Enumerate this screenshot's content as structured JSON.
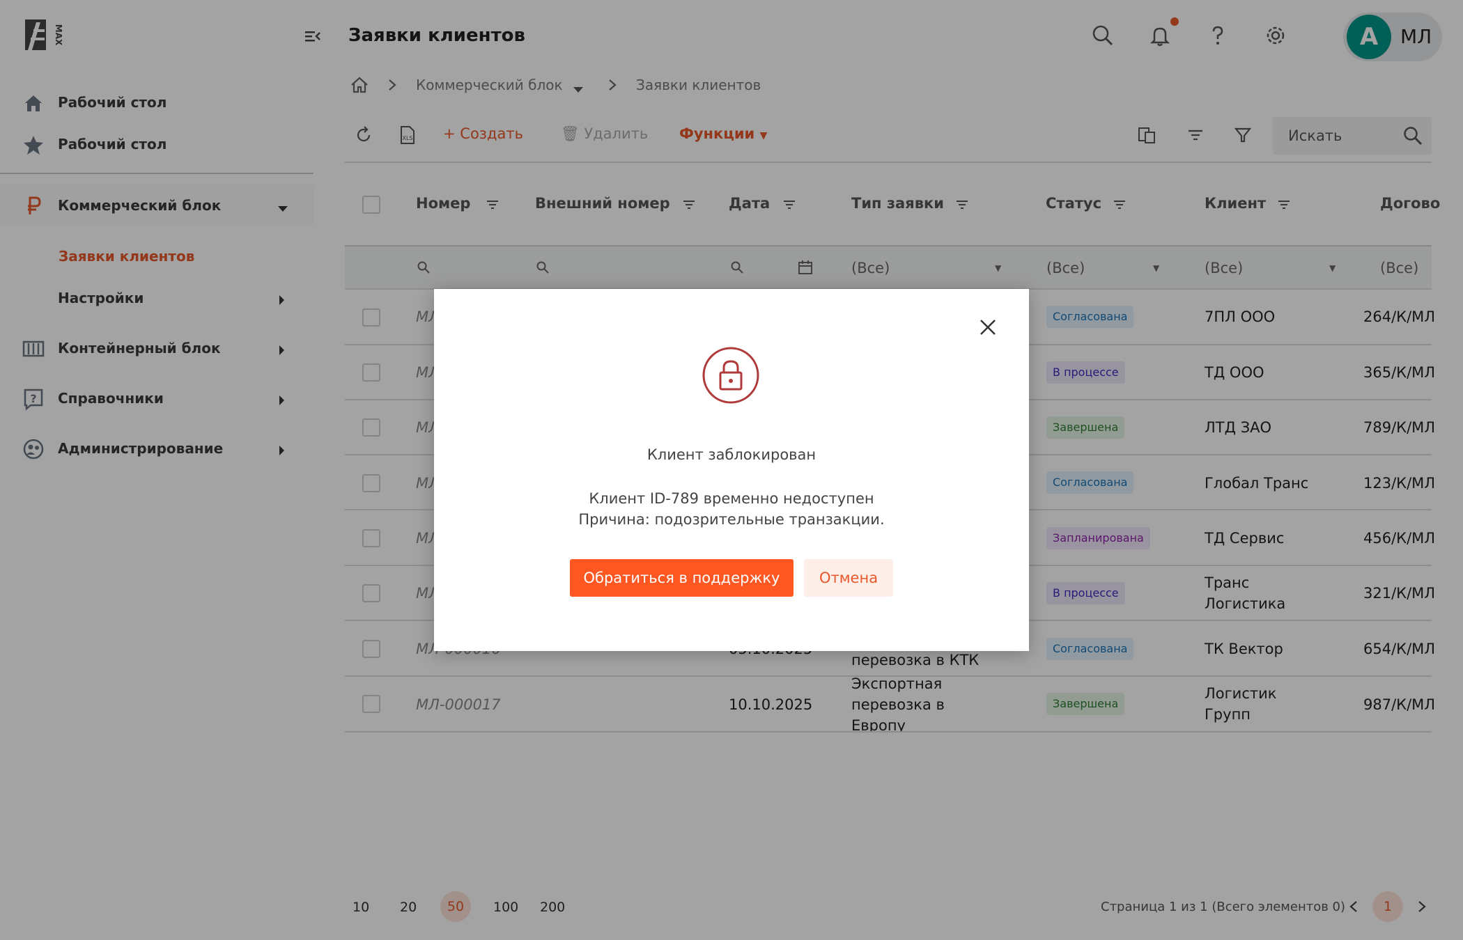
{
  "app": {
    "logo_text": "MAX"
  },
  "sidebar": {
    "items": [
      {
        "label": "Рабочий стол",
        "icon": "home-icon"
      },
      {
        "label": "Рабочий стол",
        "icon": "star-icon"
      },
      {
        "label": "Коммерческий блок",
        "icon": "ruble-icon",
        "active": true
      },
      {
        "label": "Контейнерный блок",
        "icon": "container-icon"
      },
      {
        "label": "Справочники",
        "icon": "help-book-icon"
      },
      {
        "label": "Администрирование",
        "icon": "admin-icon"
      }
    ],
    "sub_items": [
      {
        "label": "Заявки клиентов",
        "active": true
      },
      {
        "label": "Настройки"
      }
    ]
  },
  "header": {
    "title": "Заявки клиентов",
    "user_initial": "А",
    "user_short": "МЛ"
  },
  "breadcrumb": [
    "Коммерческий блок",
    "Заявки клиентов"
  ],
  "toolbar": {
    "create_label": "Создать",
    "delete_label": "Удалить",
    "functions_label": "Функции",
    "search_placeholder": "Искать"
  },
  "table": {
    "columns": [
      "Номер",
      "Внешний номер",
      "Дата",
      "Тип заявки",
      "Статус",
      "Клиент",
      "Догово"
    ],
    "filter_all": "(Все)",
    "rows": [
      {
        "number": "МЛ",
        "status": "Согласована",
        "client": "7ПЛ ООО",
        "contract": "264/К/МЛ"
      },
      {
        "number": "МЛ",
        "status": "В процессе",
        "client": "ТД ООО",
        "contract": "365/К/МЛ"
      },
      {
        "number": "МЛ",
        "status": "Завершена",
        "client": "ЛТД ЗАО",
        "contract": "789/К/МЛ"
      },
      {
        "number": "МЛ",
        "status": "Согласована",
        "client": "Глобал Транс",
        "contract": "123/К/МЛ"
      },
      {
        "number": "МЛ",
        "status": "Запланирована",
        "client": "ТД Сервис",
        "contract": "456/К/МЛ"
      },
      {
        "number": "МЛ",
        "status": "В процессе",
        "client": "Транс Логистика",
        "contract": "321/К/МЛ"
      },
      {
        "number": "МЛ-000016",
        "date": "05.10.2025",
        "type": "перевозка в КТК",
        "status": "Согласована",
        "client": "ТК Вектор",
        "contract": "654/К/МЛ"
      },
      {
        "number": "МЛ-000017",
        "date": "10.10.2025",
        "type": "Экспортная перевозка в Европу",
        "status": "Завершена",
        "client": "Логистик Групп",
        "contract": "987/К/МЛ"
      }
    ]
  },
  "status_colors": {
    "Согласована": {
      "bg": "#e3f1fb",
      "fg": "#1a73b8"
    },
    "В процессе": {
      "bg": "#ece8fb",
      "fg": "#3f2bbd"
    },
    "Завершена": {
      "bg": "#e6f4e6",
      "fg": "#2e7d32"
    },
    "Запланирована": {
      "bg": "#f1e6fb",
      "fg": "#8e24aa"
    }
  },
  "pagination": {
    "sizes": [
      "10",
      "20",
      "50",
      "100",
      "200"
    ],
    "active_size": "50",
    "info": "Страница 1 из 1  (Всего элементов 0)",
    "current_page": "1"
  },
  "modal": {
    "title": "Клиент заблокирован",
    "message_line1": "Клиент ID-789 временно недоступен",
    "message_line2": "Причина: подозрительные транзакции.",
    "primary_label": "Обратиться в поддержку",
    "secondary_label": "Отмена"
  },
  "colors": {
    "accent": "#e8582b",
    "primary_button": "#ff5722",
    "avatar": "#009688"
  }
}
